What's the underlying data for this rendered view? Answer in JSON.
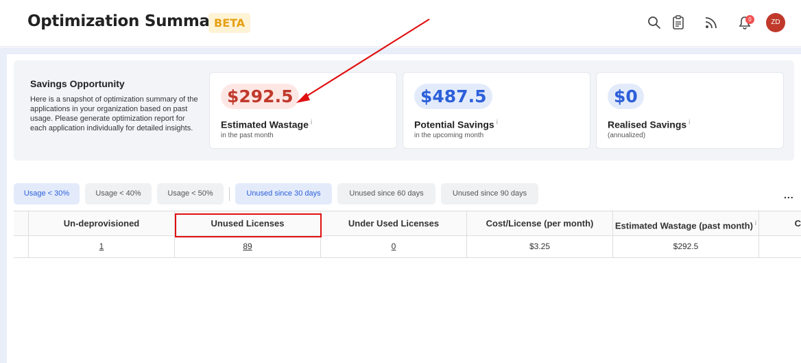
{
  "header": {
    "title": "Optimization Summary",
    "badge": "BETA",
    "notification_count": "0",
    "avatar_initials": "ZD"
  },
  "savings": {
    "title": "Savings Opportunity",
    "description": "Here is a snapshot of optimization summary of the applications in your organization based on past usage. Please generate optimization report for each application individually for detailed insights.",
    "cards": [
      {
        "amount": "$292.5",
        "label": "Estimated Wastage",
        "info": "i",
        "sub": "in the past month"
      },
      {
        "amount": "$487.5",
        "label": "Potential Savings",
        "info": "i",
        "sub": "in the upcoming month"
      },
      {
        "amount": "$0",
        "label": "Realised Savings",
        "info": "i",
        "sub": "(annualized)"
      }
    ]
  },
  "filters": [
    {
      "label": "Usage < 30%",
      "active": true
    },
    {
      "label": "Usage < 40%",
      "active": false
    },
    {
      "label": "Usage < 50%",
      "active": false
    },
    {
      "label": "Unused since 30 days",
      "active": true
    },
    {
      "label": "Unused since 60 days",
      "active": false
    },
    {
      "label": "Unused since 90 days",
      "active": false
    }
  ],
  "more_label": "...",
  "table": {
    "columns": [
      "Un-deprovisioned",
      "Unused Licenses",
      "Under Used Licenses",
      "Cost/License (per month)",
      "Estimated Wastage (past month)",
      "C"
    ],
    "wastage_info": "i",
    "rows": [
      [
        "1",
        "89",
        "0",
        "$3.25",
        "$292.5",
        ""
      ]
    ]
  },
  "colors": {
    "accent_blue": "#2c5fd9",
    "wastage_red": "#c0392b",
    "beta_orange": "#e5a013",
    "annotation_red": "#e01010"
  }
}
